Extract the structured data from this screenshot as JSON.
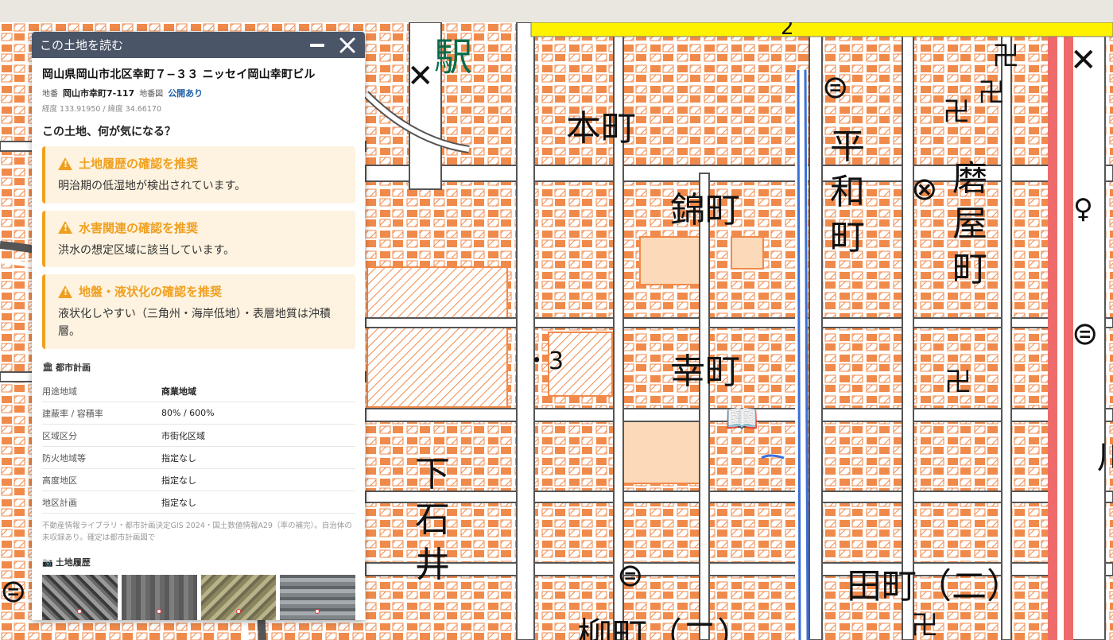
{
  "panel": {
    "title": "この土地を読む",
    "minimize_label": "minimize",
    "close_label": "close",
    "address": "岡山県岡山市北区幸町７−３３ ニッセイ岡山幸町ビル",
    "chiban_label": "地番",
    "chiban_value": "岡山市幸町7-117",
    "chibanzu_label": "地番図",
    "chibanzu_status": "公開あり",
    "coords": "経度 133.91950 / 緯度 34.66170",
    "question": "この土地、何が気になる？",
    "alerts": [
      {
        "title": "土地履歴の確認を推奨",
        "text": "明治期の低湿地が検出されています。"
      },
      {
        "title": "水害関連の確認を推奨",
        "text": "洪水の想定区域に該当しています。"
      },
      {
        "title": "地盤・液状化の確認を推奨",
        "text": "液状化しやすい（三角州・海岸低地）・表層地質は沖積層。"
      }
    ],
    "city_plan": {
      "title": "都市計画",
      "icon": "building-columns-icon",
      "rows": [
        {
          "key": "用途地域",
          "value": "商業地域"
        },
        {
          "key": "建蔽率 / 容積率",
          "value": "80% / 600%"
        },
        {
          "key": "区域区分",
          "value": "市街化区域"
        },
        {
          "key": "防火地域等",
          "value": "指定なし"
        },
        {
          "key": "高度地区",
          "value": "指定なし"
        },
        {
          "key": "地区計画",
          "value": "指定なし"
        }
      ],
      "source": "不動産情報ライブラリ・都市計画決定GIS 2024・国土数値情報A29（率の補完）。自治体の未収録あり。確定は都市計画図で"
    },
    "land_history": {
      "title": "土地履歴",
      "icon": "camera-icon"
    }
  },
  "map": {
    "labels": {
      "eki": "駅",
      "honmachi": "本町",
      "nishikimachi": "錦町",
      "heiwa": "平和町",
      "togiya": "磨屋町",
      "saiwai": "幸町",
      "shimoishii": "下石井",
      "tamachi": "田町（二）",
      "yanagimachi": "柳町（二）",
      "num3": "・3",
      "num2": "2",
      "kawa": "川"
    }
  },
  "colors": {
    "header_bg": "#4a5568",
    "alert_accent": "#f0a020",
    "alert_bg": "#fdf3e0",
    "link": "#1f5fa8",
    "building": "#f08a4b",
    "road_red": "#ef6b6b",
    "water": "#3a6fd8",
    "yellow": "#fff200"
  }
}
